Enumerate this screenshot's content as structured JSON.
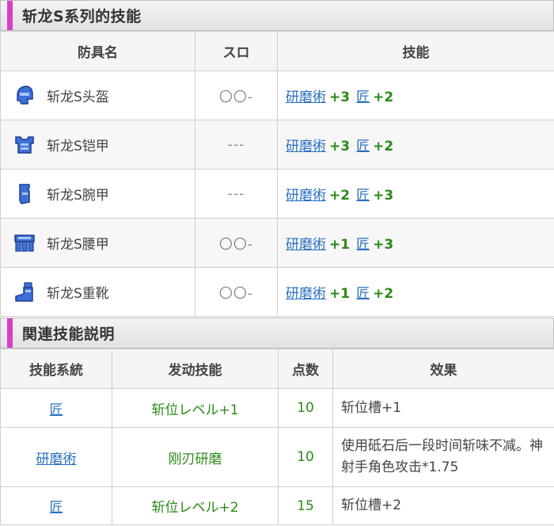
{
  "armor_section": {
    "title": "斩龙S系列的技能",
    "headers": [
      "防具名",
      "スロ",
      "技能"
    ],
    "rows": [
      {
        "icon": "helmet-icon",
        "name": "斩龙S头盔",
        "slots": "〇〇-",
        "skill1": "研磨術",
        "val1": "+3",
        "skill2": "匠",
        "val2": "+2"
      },
      {
        "icon": "chest-armor-icon",
        "name": "斩龙S铠甲",
        "slots": "---",
        "skill1": "研磨術",
        "val1": "+3",
        "skill2": "匠",
        "val2": "+2"
      },
      {
        "icon": "arm-guard-icon",
        "name": "斩龙S腕甲",
        "slots": "---",
        "skill1": "研磨術",
        "val1": "+2",
        "skill2": "匠",
        "val2": "+3"
      },
      {
        "icon": "waist-armor-icon",
        "name": "斩龙S腰甲",
        "slots": "〇〇-",
        "skill1": "研磨術",
        "val1": "+1",
        "skill2": "匠",
        "val2": "+3"
      },
      {
        "icon": "boots-icon",
        "name": "斩龙S重靴",
        "slots": "〇〇-",
        "skill1": "研磨術",
        "val1": "+1",
        "skill2": "匠",
        "val2": "+2"
      }
    ]
  },
  "related_section": {
    "title": "関連技能説明",
    "headers": [
      "技能系統",
      "发动技能",
      "点数",
      "效果"
    ],
    "rows": [
      {
        "system": "匠",
        "skill": "斩位レベル+1",
        "points": "10",
        "effect": "斩位槽+1"
      },
      {
        "system": "研磨術",
        "skill": "刚刃研磨",
        "points": "10",
        "effect": "使用砥石后一段时间斩味不减。神射手角色攻击*1.75"
      },
      {
        "system": "匠",
        "skill": "斩位レベル+2",
        "points": "15",
        "effect": "斩位槽+2"
      }
    ]
  },
  "colors": {
    "accent": "#d63fc9",
    "link": "#2a6fc1",
    "positive": "#2b8a17",
    "icon_blue": "#3d6fd6"
  }
}
